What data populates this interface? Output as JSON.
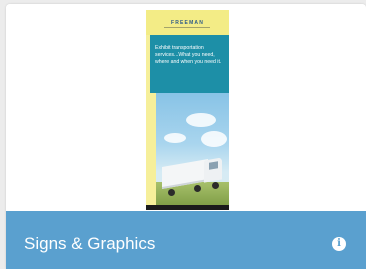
{
  "card": {
    "image": {
      "banner_brand": "FREEMAN",
      "banner_copy": "Exhibit transportation services...What you need, where and when you need it."
    },
    "title": "Signs & Graphics",
    "info_icon": "info-icon",
    "info_glyph": "i"
  },
  "colors": {
    "footer_bg": "#5aa0cf",
    "banner_teal": "#1d8fa7",
    "banner_yellow": "#f6ef9a"
  }
}
